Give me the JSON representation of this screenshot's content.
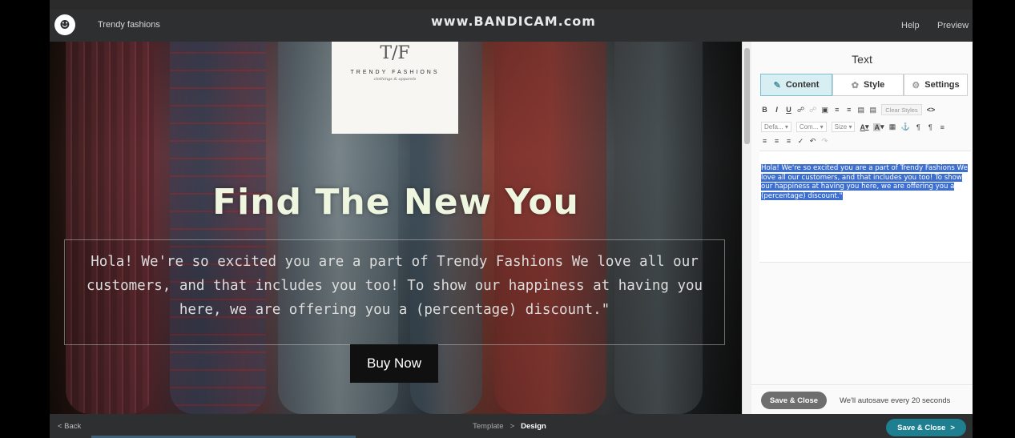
{
  "topbar": {
    "brand": "Trendy fashions",
    "watermark": "www.BANDICAM.com",
    "help": "Help",
    "preview": "Preview"
  },
  "email": {
    "logo_mark": "T/F",
    "logo_name": "TRENDY FASHIONS",
    "logo_tagline": "clothings & apparels",
    "hero_title": "Find The New You",
    "hero_text": "Hola! We're so excited you are a part of Trendy Fashions We love all our customers, and that includes you too! To show our happiness at having you here, we are offering you a (percentage) discount.\"",
    "cta": "Buy Now"
  },
  "panel": {
    "title": "Text",
    "tabs": [
      {
        "label": "Content",
        "icon": "pencil-icon",
        "active": true
      },
      {
        "label": "Style",
        "icon": "brush-icon",
        "active": false
      },
      {
        "label": "Settings",
        "icon": "gear-icon",
        "active": false
      }
    ],
    "toolbar": {
      "bold": "B",
      "italic": "I",
      "underline": "U",
      "clear_styles": "Clear Styles",
      "source": "<>",
      "font_dropdown": "Defa...",
      "format_dropdown": "Com...",
      "size_dropdown": "Size",
      "text_color": "A",
      "bg_color": "A"
    },
    "editor_text": "Hola! We're so excited you are a part of Trendy Fashions We love all our customers, and that includes you too! To show our happiness at having you here, we are offering you a (percentage) discount.\"",
    "save_close": "Save & Close",
    "autosave": "We'll autosave every 20 seconds"
  },
  "bottombar": {
    "back": "< Back",
    "crumb_template": "Template",
    "crumb_sep": ">",
    "crumb_design": "Design",
    "save_close": "Save & Close",
    "save_close_arrow": ">"
  },
  "colors": {
    "accent": "#1d7f8f",
    "selection": "#3d6fd1",
    "active_tab_bg": "#d7eef2"
  }
}
